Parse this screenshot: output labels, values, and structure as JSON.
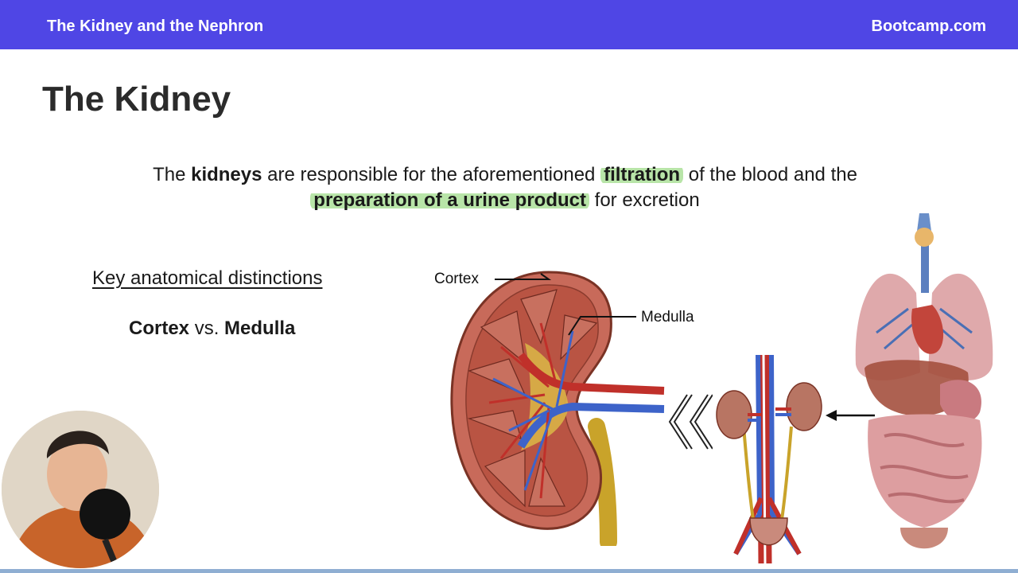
{
  "header": {
    "course_title": "The Kidney and the Nephron",
    "brand": "Bootcamp.com",
    "bar_color": "#4f46e5"
  },
  "slide": {
    "title": "The Kidney",
    "intro": {
      "part1": "The ",
      "kidneys": "kidneys",
      "part2": " are responsible for the aforementioned ",
      "filtration": "filtration",
      "part3": " of the blood and the",
      "urine": "preparation of a urine product",
      "part4": " for excretion"
    },
    "highlight_color": "#7ecf60",
    "subheading": "Key anatomical distinctions",
    "contrast": {
      "term1": "Cortex",
      "vs": " vs. ",
      "term2": "Medulla"
    }
  },
  "diagram": {
    "cortex_label": "Cortex",
    "medulla_label": "Medulla"
  },
  "webcam": {
    "icon": "presenter-webcam"
  }
}
